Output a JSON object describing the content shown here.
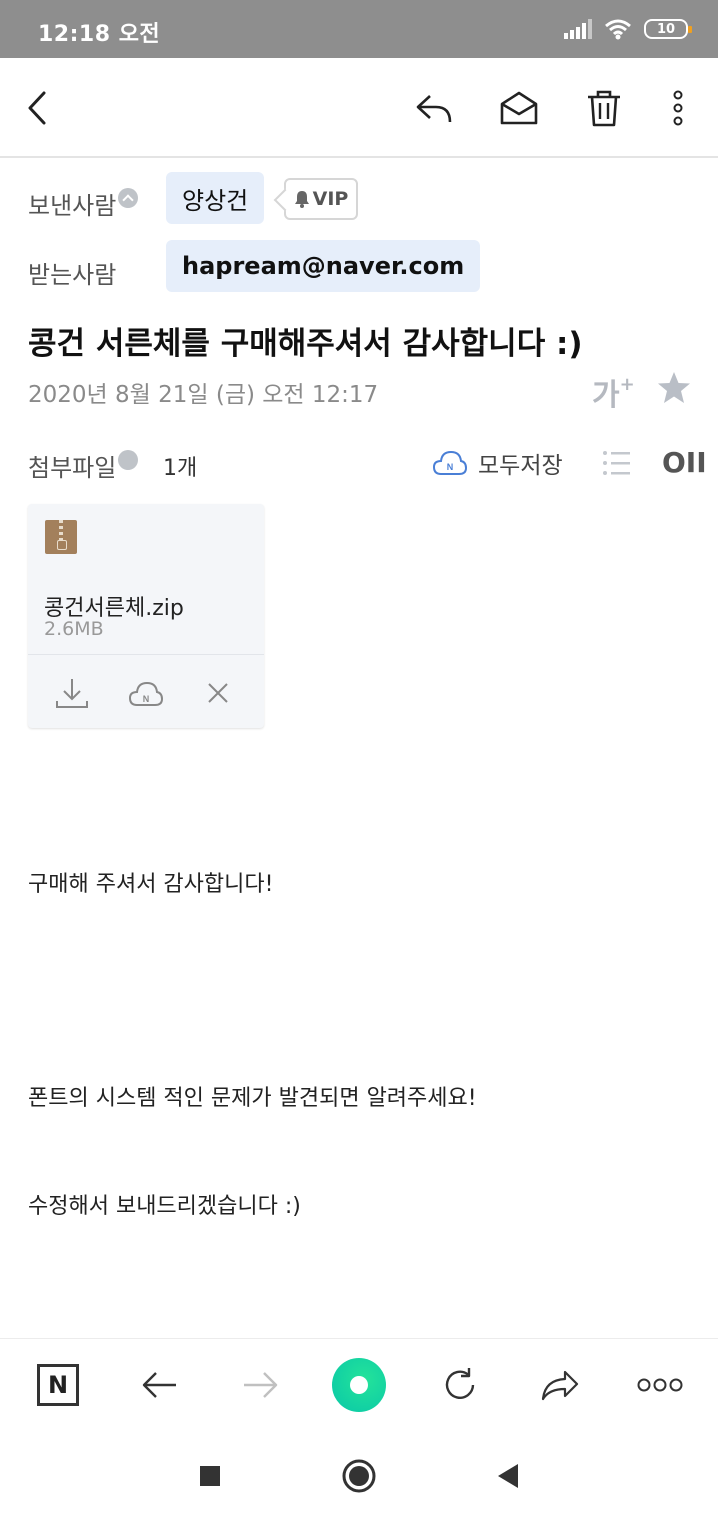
{
  "status_bar": {
    "time": "12:18 오전",
    "battery": "10"
  },
  "header": {
    "sender_label": "보낸사람",
    "sender_name": "양상건",
    "vip_label": "VIP",
    "recipient_label": "받는사람",
    "recipient_email": "hapream@naver.com"
  },
  "mail": {
    "subject": "콩건 서른체를 구매해주셔서 감사합니다 :)",
    "date": "2020년 8월 21일 (금) 오전 12:17",
    "font_size_glyph": "가",
    "font_size_plus": "+"
  },
  "attachments": {
    "label": "첨부파일",
    "count": "1개",
    "save_all_label": "모두저장",
    "grid_view_label": "OII",
    "files": [
      {
        "name": "콩건서른체.zip",
        "size": "2.6MB"
      }
    ]
  },
  "body": {
    "lines": [
      "구매해 주셔서 감사합니다!",
      "폰트의 시스템 적인 문제가 발견되면 알려주세요!",
      "수정해서 보내드리겠습니다 :)"
    ]
  },
  "bottom_bar": {
    "logo": "N"
  },
  "colors": {
    "status_bar": "#8e8e8e",
    "chip_bg": "#e6eefa",
    "accent_green": "#10d6a0",
    "cloud_blue": "#4a7fd6"
  }
}
